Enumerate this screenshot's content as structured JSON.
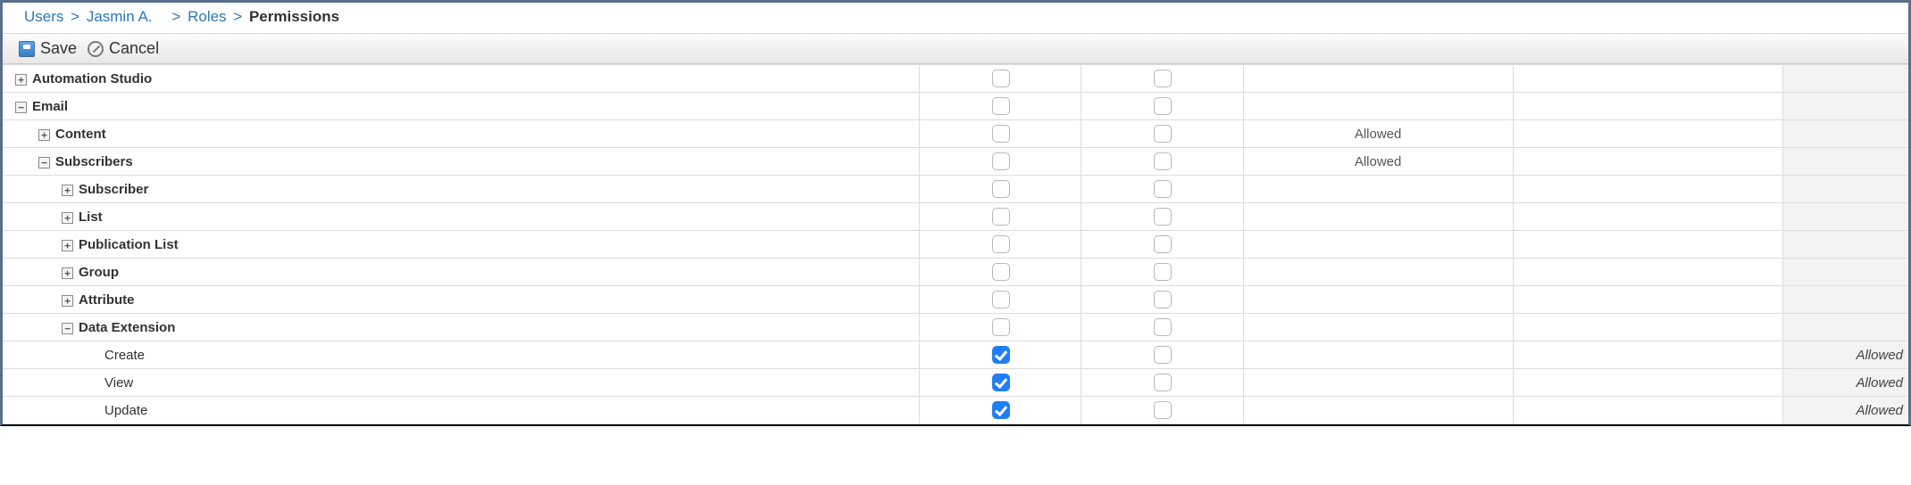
{
  "breadcrumb": {
    "users": "Users",
    "user_name": "Jasmin A.",
    "roles": "Roles",
    "current": "Permissions",
    "sep": ">"
  },
  "toolbar": {
    "save": "Save",
    "cancel": "Cancel"
  },
  "status": {
    "allowed": "Allowed"
  },
  "tree": {
    "plus": "+",
    "minus": "−"
  },
  "rows": [
    {
      "id": "automation-studio",
      "label": "Automation Studio",
      "level": 0,
      "bold": true,
      "toggle": "plus",
      "cb1": false,
      "cb2": false,
      "stat1": "",
      "stat3": ""
    },
    {
      "id": "email",
      "label": "Email",
      "level": 0,
      "bold": true,
      "toggle": "minus",
      "cb1": false,
      "cb2": false,
      "stat1": "",
      "stat3": ""
    },
    {
      "id": "content",
      "label": "Content",
      "level": 1,
      "bold": true,
      "toggle": "plus",
      "cb1": false,
      "cb2": false,
      "stat1": "Allowed",
      "stat3": ""
    },
    {
      "id": "subscribers",
      "label": "Subscribers",
      "level": 1,
      "bold": true,
      "toggle": "minus",
      "cb1": false,
      "cb2": false,
      "stat1": "Allowed",
      "stat3": ""
    },
    {
      "id": "subscriber",
      "label": "Subscriber",
      "level": 2,
      "bold": true,
      "toggle": "plus",
      "cb1": false,
      "cb2": false,
      "stat1": "",
      "stat3": ""
    },
    {
      "id": "list",
      "label": "List",
      "level": 2,
      "bold": true,
      "toggle": "plus",
      "cb1": false,
      "cb2": false,
      "stat1": "",
      "stat3": ""
    },
    {
      "id": "publication-list",
      "label": "Publication List",
      "level": 2,
      "bold": true,
      "toggle": "plus",
      "cb1": false,
      "cb2": false,
      "stat1": "",
      "stat3": ""
    },
    {
      "id": "group",
      "label": "Group",
      "level": 2,
      "bold": true,
      "toggle": "plus",
      "cb1": false,
      "cb2": false,
      "stat1": "",
      "stat3": ""
    },
    {
      "id": "attribute",
      "label": "Attribute",
      "level": 2,
      "bold": true,
      "toggle": "plus",
      "cb1": false,
      "cb2": false,
      "stat1": "",
      "stat3": ""
    },
    {
      "id": "data-extension",
      "label": "Data Extension",
      "level": 2,
      "bold": true,
      "toggle": "minus",
      "cb1": false,
      "cb2": false,
      "stat1": "",
      "stat3": ""
    },
    {
      "id": "de-create",
      "label": "Create",
      "level": 3,
      "bold": false,
      "toggle": "",
      "cb1": true,
      "cb2": false,
      "stat1": "",
      "stat3": "Allowed"
    },
    {
      "id": "de-view",
      "label": "View",
      "level": 3,
      "bold": false,
      "toggle": "",
      "cb1": true,
      "cb2": false,
      "stat1": "",
      "stat3": "Allowed"
    },
    {
      "id": "de-update",
      "label": "Update",
      "level": 3,
      "bold": false,
      "toggle": "",
      "cb1": true,
      "cb2": false,
      "stat1": "",
      "stat3": "Allowed"
    }
  ]
}
